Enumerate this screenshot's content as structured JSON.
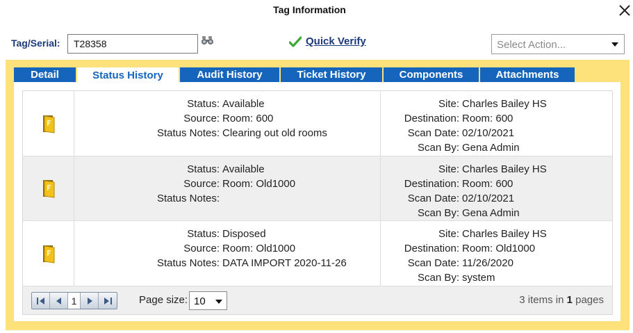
{
  "dialog": {
    "title": "Tag Information"
  },
  "tag": {
    "label": "Tag/Serial:",
    "value": "T28358"
  },
  "quick_verify": {
    "label": "Quick Verify"
  },
  "action_select": {
    "placeholder": "Select Action..."
  },
  "tabs": [
    {
      "label": "Detail",
      "active": false
    },
    {
      "label": "Status History",
      "active": true
    },
    {
      "label": "Audit History",
      "active": false
    },
    {
      "label": "Ticket History",
      "active": false
    },
    {
      "label": "Components",
      "active": false
    },
    {
      "label": "Attachments",
      "active": false
    }
  ],
  "field_labels": {
    "status": "Status:",
    "source": "Source:",
    "status_notes": "Status Notes:",
    "site": "Site:",
    "destination": "Destination:",
    "scan_date": "Scan Date:",
    "scan_by": "Scan By:"
  },
  "history": [
    {
      "status": "Available",
      "source": "Room: 600",
      "status_notes": "Clearing out old rooms",
      "site": "Charles Bailey HS",
      "destination": "Room: 600",
      "scan_date": "02/10/2021",
      "scan_by": "Gena Admin"
    },
    {
      "status": "Available",
      "source": "Room: Old1000",
      "status_notes": "",
      "site": "Charles Bailey HS",
      "destination": "Room: 600",
      "scan_date": "02/10/2021",
      "scan_by": "Gena Admin"
    },
    {
      "status": "Disposed",
      "source": "Room: Old1000",
      "status_notes": "DATA IMPORT 2020-11-26",
      "site": "Charles Bailey HS",
      "destination": "Room: Old1000",
      "scan_date": "11/26/2020",
      "scan_by": "system"
    }
  ],
  "pager": {
    "current_page": "1",
    "page_size_label": "Page size:",
    "page_size": "10",
    "items_count": "3",
    "items_text": "items in",
    "pages_count": "1",
    "pages_text": "pages"
  },
  "colors": {
    "accent": "#1665bd",
    "panel": "#fde17a",
    "icon": "#f2c21b"
  }
}
